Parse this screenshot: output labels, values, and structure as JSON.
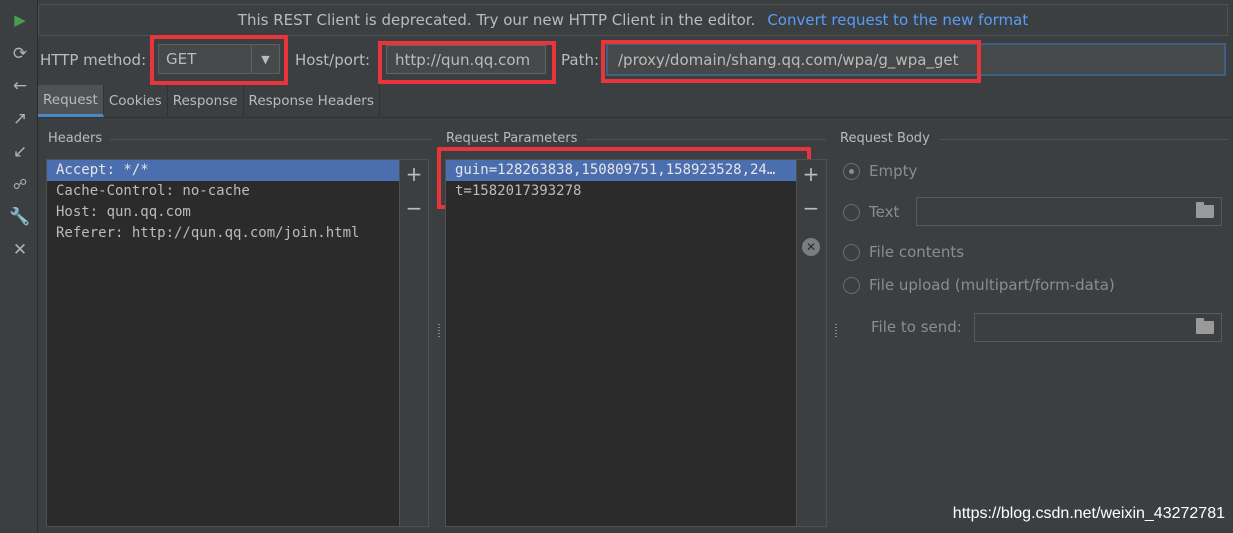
{
  "banner": {
    "message": "This REST Client is deprecated. Try our new HTTP Client in the editor.",
    "link": "Convert request to the new format"
  },
  "request": {
    "method_label": "HTTP method:",
    "method_value": "GET",
    "host_label": "Host/port:",
    "host_value": "http://qun.qq.com",
    "path_label": "Path:",
    "path_value": "/proxy/domain/shang.qq.com/wpa/g_wpa_get"
  },
  "tabs": [
    "Request",
    "Cookies",
    "Response",
    "Response Headers"
  ],
  "headers": {
    "title": "Headers",
    "items": [
      "Accept: */*",
      "Cache-Control: no-cache",
      "Host: qun.qq.com",
      "Referer: http://qun.qq.com/join.html"
    ],
    "add_glyph": "+",
    "remove_glyph": "−"
  },
  "params": {
    "title": "Request Parameters",
    "items": [
      "guin=128263838,150809751,158923528,24…",
      "t=1582017393278"
    ],
    "clear_glyph": "✕"
  },
  "body": {
    "title": "Request Body",
    "options": [
      "Empty",
      "Text",
      "File contents",
      "File upload (multipart/form-data)"
    ],
    "selected": "Empty",
    "file_to_send_label": "File to send:"
  },
  "toolbar_icons": [
    "run-icon",
    "refresh-icon",
    "back-icon",
    "export-icon",
    "import-icon",
    "http-icon",
    "settings-icon",
    "close-icon"
  ],
  "watermark": "https://blog.csdn.net/weixin_43272781",
  "colors": {
    "background": "#3c3f41",
    "list_background": "#2b2b2b",
    "selection": "#4b6eaf",
    "link": "#589df6",
    "highlight_box": "#e8353a",
    "run": "#499c54"
  }
}
